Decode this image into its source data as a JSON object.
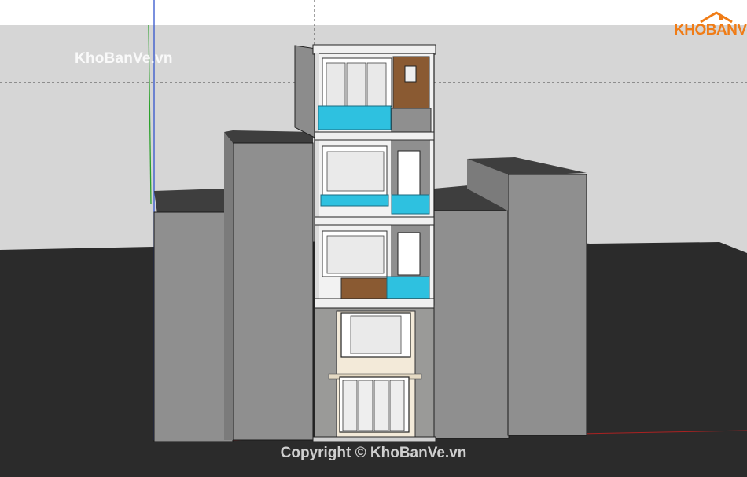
{
  "watermark": {
    "top_left": "KhoBanVe.vn",
    "logo_text": "KHOBANVE",
    "copyright": "Copyright © KhoBanVe.vn"
  },
  "colors": {
    "sky": "#ffffff",
    "ground": "#2b2b2b",
    "backdrop": "#d6d6d6",
    "neighbor_front": "#8f8f8f",
    "neighbor_side": "#7b7b7b",
    "neighbor_top": "#3e3e3e",
    "glass_balcony": "#2ec1e0",
    "wood": "#8a5a32",
    "facade_white": "#f2f2f2",
    "stone": "#9a9a98",
    "cream": "#f3ead9",
    "logo_orange": "#f07c16"
  }
}
